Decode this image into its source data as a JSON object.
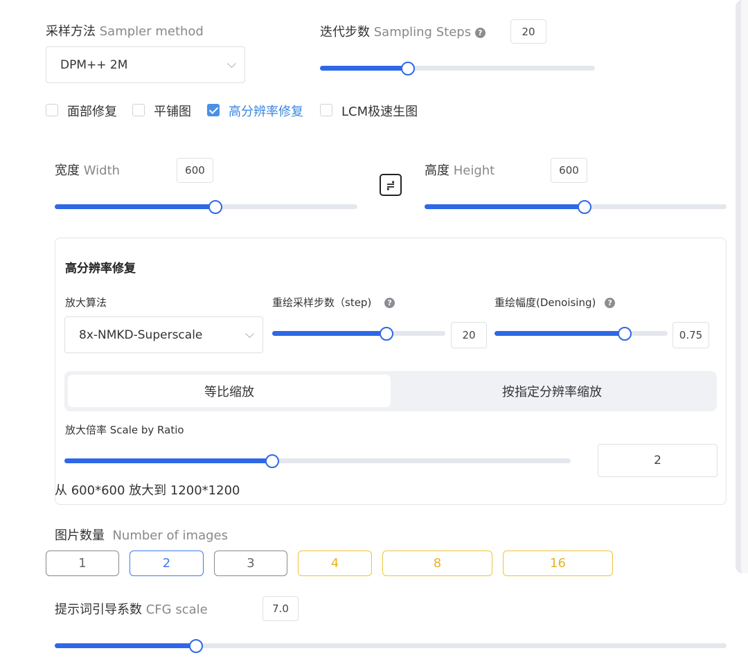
{
  "sampler": {
    "label_cn": "采样方法",
    "label_en": "Sampler method",
    "value": "DPM++ 2M"
  },
  "steps": {
    "label_cn": "迭代步数",
    "label_en": "Sampling Steps",
    "value": "20",
    "help": "?",
    "fraction": 0.32
  },
  "options": [
    {
      "label": "面部修复",
      "checked": false
    },
    {
      "label": "平铺图",
      "checked": false
    },
    {
      "label": "高分辨率修复",
      "checked": true
    },
    {
      "label": "LCM极速生图",
      "checked": false
    }
  ],
  "width": {
    "label_cn": "宽度",
    "label_en": "Width",
    "value": "600",
    "fraction": 0.53
  },
  "height": {
    "label_cn": "高度",
    "label_en": "Height",
    "value": "600",
    "fraction": 0.53
  },
  "swap_icon": "≓",
  "hires": {
    "title": "高分辨率修复",
    "upscaler": {
      "label": "放大算法",
      "value": "8x-NMKD-Superscale"
    },
    "steps": {
      "label": "重绘采样步数（step)",
      "value": "20",
      "help": "?",
      "fraction": 0.66
    },
    "denoise": {
      "label": "重绘幅度(Denoising)",
      "value": "0.75",
      "help": "?",
      "fraction": 0.75
    },
    "modes": [
      "等比缩放",
      "按指定分辨率缩放"
    ],
    "active_mode": 0,
    "ratio": {
      "label": "放大倍率 Scale by Ratio",
      "value": "2",
      "fraction": 0.41
    },
    "info": "从 600*600 放大到 1200*1200"
  },
  "images": {
    "label_cn": "图片数量",
    "label_en": "Number of images",
    "options": [
      "1",
      "2",
      "3",
      "4",
      "8",
      "16"
    ],
    "selected": "2"
  },
  "cfg": {
    "label_cn": "提示词引导系数",
    "label_en": "CFG scale",
    "value": "7.0",
    "fraction": 0.21
  },
  "colors": {
    "accent": "#2f68e6",
    "check": "#4a90e8",
    "gold": "#f0c437"
  }
}
